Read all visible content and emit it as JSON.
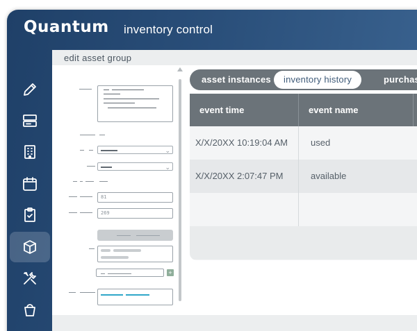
{
  "header": {
    "logo": "Quantum",
    "title": "inventory control"
  },
  "sidebar": {
    "items": [
      {
        "icon": "pencil-icon",
        "active": false
      },
      {
        "icon": "server-icon",
        "active": false
      },
      {
        "icon": "building-icon",
        "active": false
      },
      {
        "icon": "calendar-icon",
        "active": false
      },
      {
        "icon": "clipboard-check-icon",
        "active": false
      },
      {
        "icon": "box-icon",
        "active": true
      },
      {
        "icon": "tools-icon",
        "active": false
      },
      {
        "icon": "bucket-icon",
        "active": false
      }
    ]
  },
  "main": {
    "section_title": "edit asset group",
    "form": {
      "field1_value": "81",
      "field2_value": "269"
    },
    "tabs": [
      {
        "label": "asset instances",
        "active": false
      },
      {
        "label": "inventory history",
        "active": true
      },
      {
        "label": "purchas",
        "active": false
      }
    ],
    "table": {
      "columns": [
        "event time",
        "event name"
      ],
      "rows": [
        {
          "time": "X/X/20XX  10:19:04 AM",
          "name": "used"
        },
        {
          "time": "X/X/20XX  2:07:47 PM",
          "name": "available"
        }
      ]
    }
  }
}
